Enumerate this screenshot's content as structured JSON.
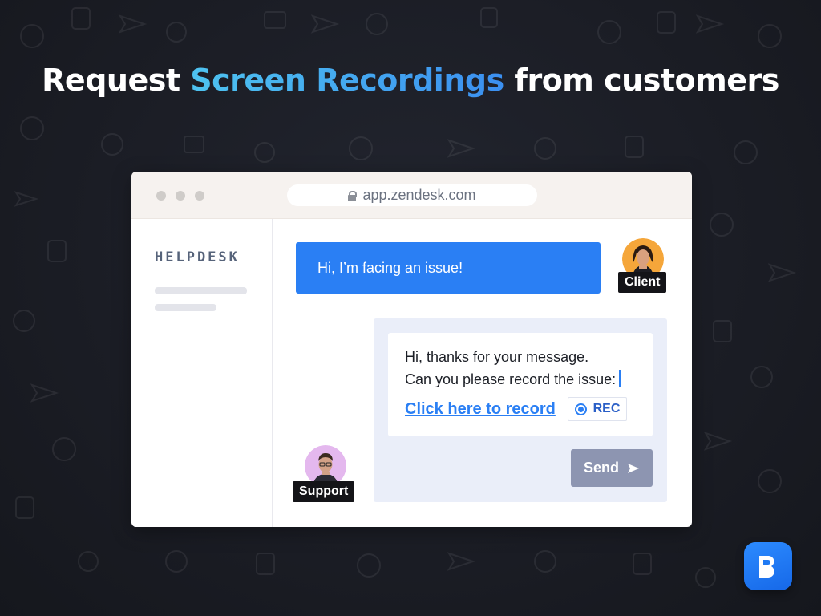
{
  "headline": {
    "prefix": "Request ",
    "accent": "Screen Recordings",
    "suffix": " from customers"
  },
  "browser": {
    "url": "app.zendesk.com"
  },
  "sidebar": {
    "logo_text": "HELPDESK"
  },
  "chat": {
    "client_message": "Hi, I’m facing an issue!",
    "client_label": "Client",
    "support_label": "Support",
    "support_message_line1": "Hi, thanks for your message.",
    "support_message_line2": "Can you please record the issue:",
    "record_link": "Click here to record",
    "rec_label": "REC",
    "send_label": "Send"
  },
  "colors": {
    "accent_blue": "#2a7ff4",
    "headline_gradient_start": "#4ec3f0",
    "send_button": "#8d95b1",
    "support_panel": "#eaeef9"
  },
  "icons": {
    "lock": "lock-icon",
    "rec": "record-dot-icon",
    "send": "send-arrow-icon",
    "brand": "brand-b-logo-icon"
  }
}
